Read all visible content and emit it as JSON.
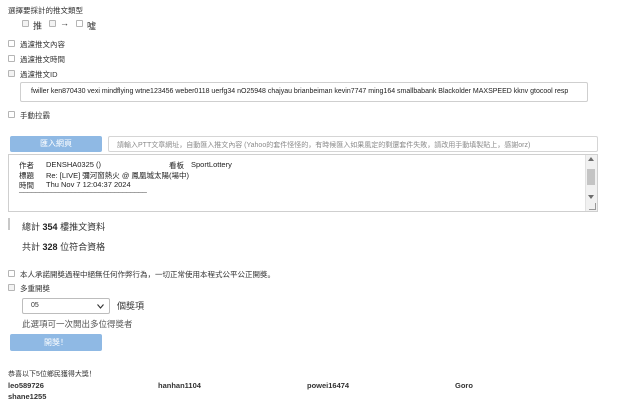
{
  "section": {
    "select_type_label": "選擇要採計的推文類型",
    "push_types": {
      "push": "推",
      "arrow": "→",
      "boo": "噓"
    }
  },
  "filters": {
    "content": "過濾推文內容",
    "time": "過濾推文時間",
    "id": "過濾推文ID",
    "manual": "手動拉霸"
  },
  "id_filter_value": "fwiller ken870430 vexi mindflying wtne123456 weber0118 uerfg34 nO25948 chajyau brianbeiman kevin7747 ming164 smallbabank Blackolder MAXSPEED kknv gtocool resp",
  "import": {
    "button": "匯入網頁",
    "url_placeholder": "請輸入PTT文章網址，自動匯入推文內容 (Yahoo的套件怪怪的，有時候匯入如果風定的剩還套件失敗，請改用手動填製貼上，感謝orz)"
  },
  "article": {
    "author_label": "作者",
    "author": "DENSHA0325 ()",
    "board_label": "看板",
    "board": "SportLottery",
    "title_label": "標題",
    "title": "Re: [LIVE] 彌河窗熱火 @ 鳳凰城太陽(場中)",
    "time_label": "時間",
    "time": "Thu Nov  7 12:04:37 2024",
    "separator": "────────────────────────────────"
  },
  "stats": {
    "total_prefix": "總計",
    "total_count": "354",
    "total_suffix": "樓推文資料",
    "qualified_prefix": "共計",
    "qualified_count": "328",
    "qualified_suffix": "位符合資格"
  },
  "options": {
    "fair_play": "本人承諾開獎過程中絕無任何作弊行為，一切正常使用本程式公平公正開獎。",
    "multi_draw": "多重開獎"
  },
  "prize": {
    "selected": "05",
    "label": "個獎項",
    "hint": "此選項可一次開出多位得獎者"
  },
  "draw_button": "開獎！",
  "result": {
    "header": "恭喜以下5位鄉民獲得大獎！",
    "winners": [
      "leo589726",
      "hanhan1104",
      "powei16474",
      "Goro",
      "shane1255"
    ]
  },
  "colors": {
    "button": "#8fb9e4",
    "border": "#cfcfcf"
  }
}
